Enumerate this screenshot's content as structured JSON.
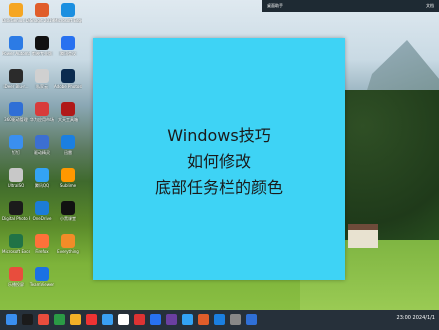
{
  "topbar": {
    "left": "桌面助手",
    "right": "文档"
  },
  "card": {
    "line1": "Windows技巧",
    "line2": "如何修改",
    "line3": "底部任务栏的颜色"
  },
  "desktop_icons": [
    {
      "label": "DiskGenius Desktop",
      "color": "#f5a623"
    },
    {
      "label": "Power Automate",
      "color": "#2c7be5"
    },
    {
      "label": "iDeer Blu-r...",
      "color": "#2b2b2b"
    },
    {
      "label": "360驱动管理",
      "color": "#2f6fd6"
    },
    {
      "label": "钉钉",
      "color": "#3a8ff0"
    },
    {
      "label": "UltraISO",
      "color": "#c8c8c8"
    },
    {
      "label": "Digital Photo Pro",
      "color": "#1b1b1b"
    },
    {
      "label": "Microsoft Excel",
      "color": "#217346"
    },
    {
      "label": "乐播投屏",
      "color": "#e84d3d"
    },
    {
      "label": "Snagit 2019",
      "color": "#e05d2a"
    },
    {
      "label": "剪映专业版",
      "color": "#111111"
    },
    {
      "label": "私家云",
      "color": "#d0d0d0"
    },
    {
      "label": "华为应用市场",
      "color": "#d83b3b"
    },
    {
      "label": "驱动精灵",
      "color": "#3c6fd1"
    },
    {
      "label": "腾讯QQ",
      "color": "#33a3f4"
    },
    {
      "label": "OneDrive",
      "color": "#1c7cd6"
    },
    {
      "label": "Firefox",
      "color": "#ff7139"
    },
    {
      "label": "TeamViewer",
      "color": "#1b71e4"
    },
    {
      "label": "Microsoft Edge",
      "color": "#1b8fe0"
    },
    {
      "label": "腾讯会议",
      "color": "#2871f0"
    },
    {
      "label": "Adobe Photoshop",
      "color": "#0b2b4f"
    },
    {
      "label": "大天工具箱",
      "color": "#b01818"
    },
    {
      "label": "迅雷",
      "color": "#1b7fe0"
    },
    {
      "label": "Sublime",
      "color": "#ff9800"
    },
    {
      "label": "小黑课堂",
      "color": "#111111"
    },
    {
      "label": "Everything",
      "color": "#f28c28"
    }
  ],
  "taskbar": {
    "time": "23:00",
    "date": "2024/1/1"
  }
}
